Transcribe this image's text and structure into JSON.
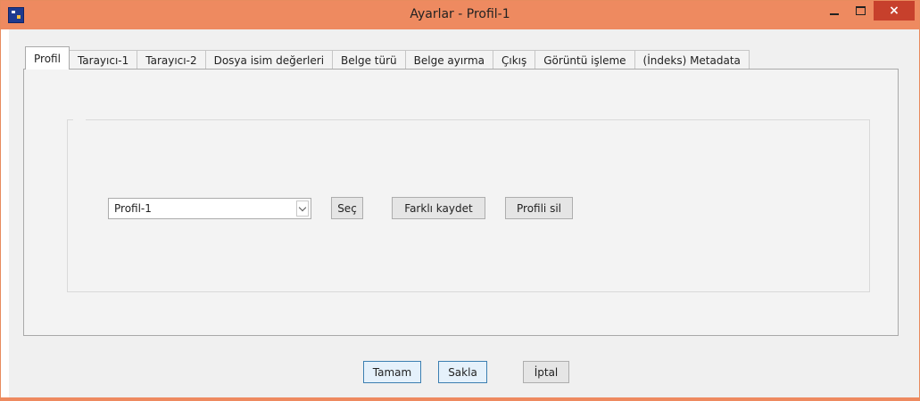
{
  "window": {
    "title": "Ayarlar - Profil-1",
    "accent_color": "#ee8a60",
    "close_color": "#c7402c"
  },
  "window_controls": {
    "minimize_icon": "minimize-icon",
    "maximize_icon": "maximize-icon",
    "close_icon": "close-icon",
    "close_glyph": "×"
  },
  "tabs": [
    {
      "label": "Profil"
    },
    {
      "label": "Tarayıcı-1"
    },
    {
      "label": "Tarayıcı-2"
    },
    {
      "label": "Dosya isim değerleri"
    },
    {
      "label": "Belge türü"
    },
    {
      "label": "Belge ayırma"
    },
    {
      "label": "Çıkış"
    },
    {
      "label": "Görüntü işleme"
    },
    {
      "label": "(İndeks) Metadata"
    }
  ],
  "active_tab": "Profil",
  "profile": {
    "selected": "Profil-1",
    "select_label": "Seç",
    "save_as_label": "Farklı kaydet",
    "delete_label": "Profili sil"
  },
  "footer": {
    "ok_label": "Tamam",
    "save_label": "Sakla",
    "cancel_label": "İptal"
  }
}
